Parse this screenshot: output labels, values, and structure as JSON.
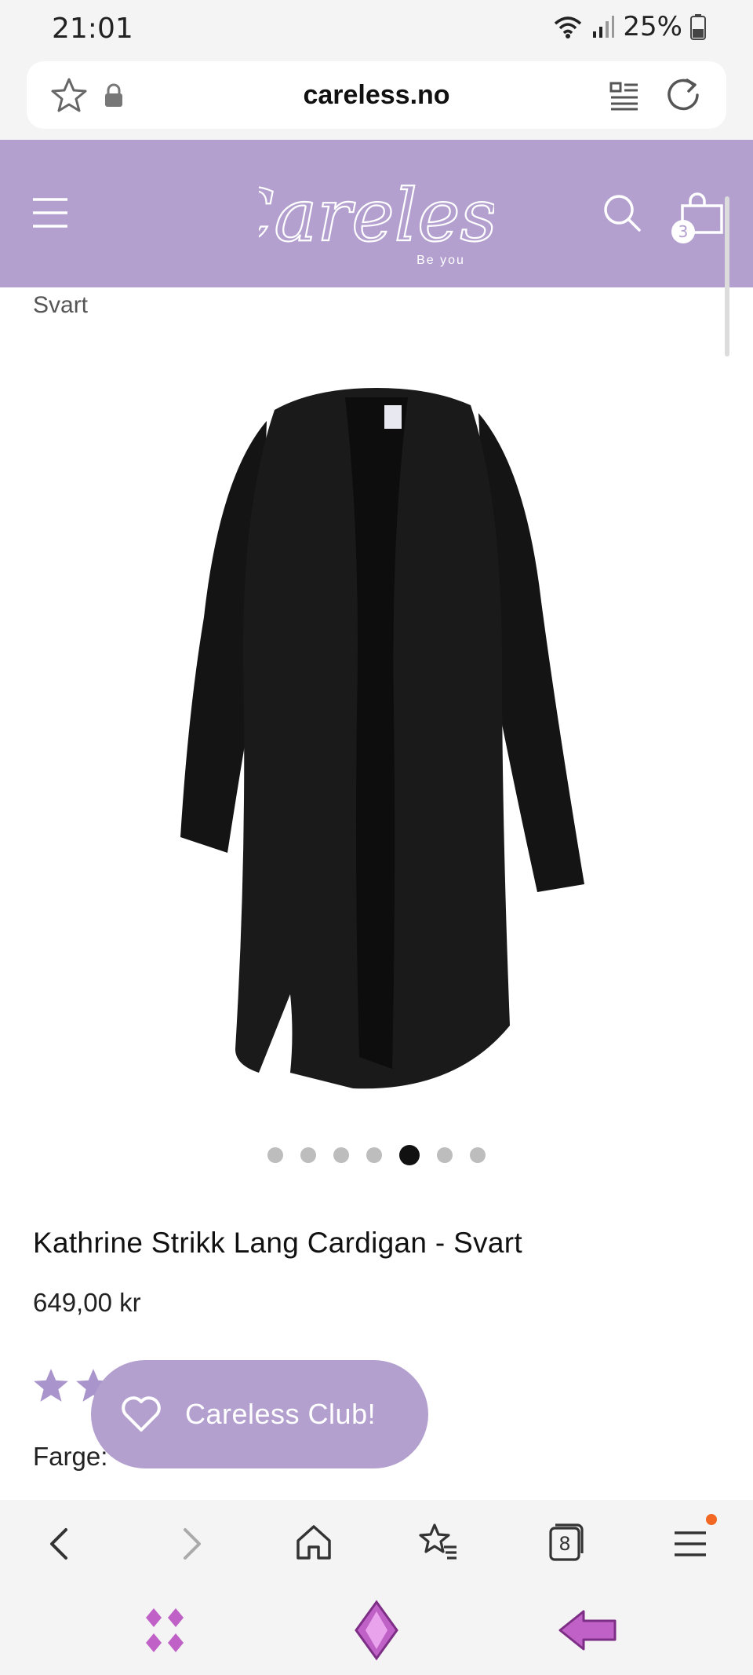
{
  "status_bar": {
    "time": "21:01",
    "battery_percent": "25%"
  },
  "browser": {
    "url": "careless.no",
    "tab_count": "8"
  },
  "site": {
    "brand_name": "Careless",
    "tagline": "Be you",
    "cart_count": "3",
    "header_color": "#b3a0cf"
  },
  "product": {
    "variant": "Svart",
    "title": "Kathrine Strikk Lang Cardigan - Svart",
    "price": "649,00 kr",
    "color_label": "Farge:",
    "image_count": 7,
    "active_image_index": 5
  },
  "club_button": {
    "label": "Careless Club!"
  },
  "icons": {
    "header": [
      "menu-icon",
      "search-icon",
      "shopping-bag-icon"
    ],
    "browser_top": [
      "star-icon",
      "lock-icon",
      "reader-mode-icon",
      "reload-icon"
    ],
    "browser_bottom": [
      "back-icon",
      "forward-icon",
      "home-icon",
      "bookmarks-icon",
      "tabs-icon",
      "menu-icon"
    ]
  }
}
